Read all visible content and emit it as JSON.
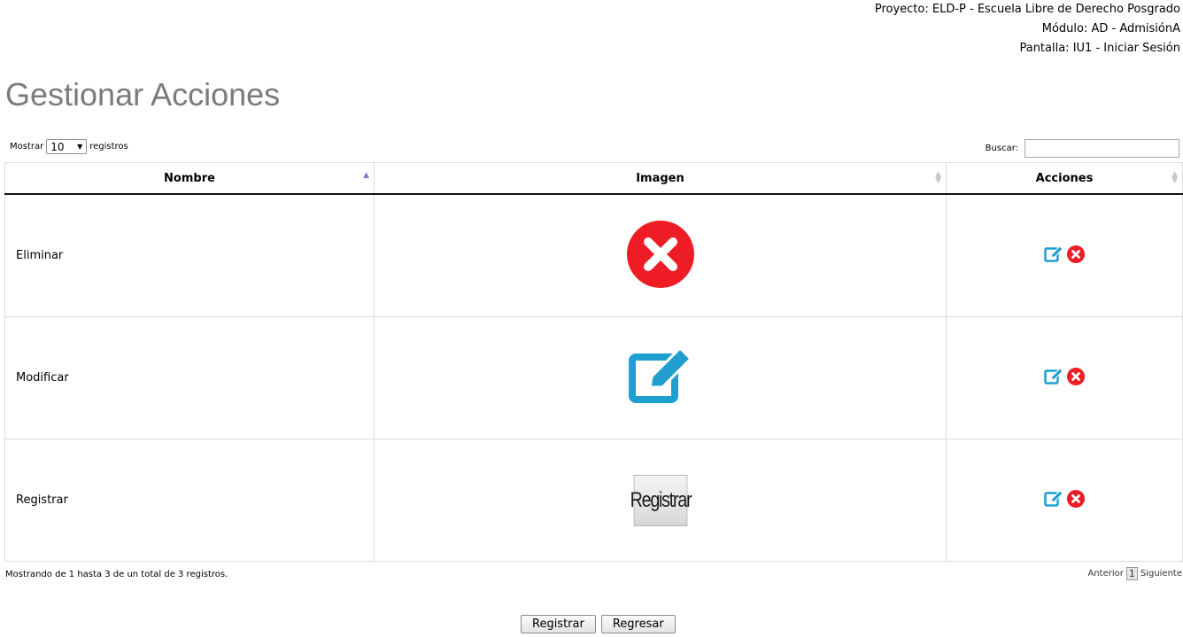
{
  "header": {
    "proyecto": "Proyecto: ELD-P - Escuela Libre de Derecho Posgrado",
    "modulo": "Módulo: AD - AdmisiónA",
    "pantalla": "Pantalla: IU1 - Iniciar Sesión"
  },
  "page": {
    "title": "Gestionar Acciones"
  },
  "length_menu": {
    "prefix": "Mostrar",
    "value": "10",
    "suffix": "registros"
  },
  "search": {
    "label": "Buscar:",
    "value": ""
  },
  "table": {
    "columns": [
      "Nombre",
      "Imagen",
      "Acciones"
    ],
    "rows": [
      {
        "nombre": "Eliminar",
        "imagen": "delete-x-icon"
      },
      {
        "nombre": "Modificar",
        "imagen": "edit-icon"
      },
      {
        "nombre": "Registrar",
        "imagen": "registrar-button-image",
        "imagen_text": "Registrar"
      }
    ]
  },
  "info": "Mostrando de 1 hasta 3 de un total de 3 registros.",
  "pagination": {
    "previous": "Anterior",
    "current": "1",
    "next": "Siguiente"
  },
  "buttons": {
    "registrar": "Registrar",
    "regresar": "Regresar"
  },
  "colors": {
    "title": "#7b7b7b",
    "edit_blue": "#1f9fd0",
    "delete_red": "#ee1c25"
  }
}
